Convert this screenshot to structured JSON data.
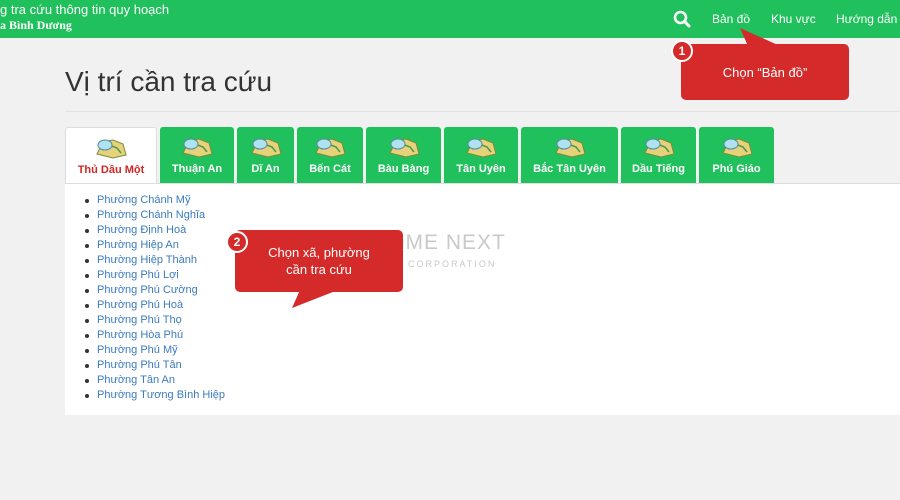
{
  "header": {
    "title_line1": "g tra cứu thông tin quy hoạch",
    "title_line2": "a Bình Dương",
    "search_icon": "search-icon",
    "nav": [
      {
        "label": "Bản đồ"
      },
      {
        "label": "Khu vực"
      },
      {
        "label": "Hướng dẫn"
      }
    ]
  },
  "page": {
    "title": "Vị trí cần tra cứu"
  },
  "tabs": [
    {
      "label": "Thủ Dầu Một",
      "active": true
    },
    {
      "label": "Thuận An"
    },
    {
      "label": "Dĩ An"
    },
    {
      "label": "Bến Cát"
    },
    {
      "label": "Bàu Bàng"
    },
    {
      "label": "Tân Uyên"
    },
    {
      "label": "Bắc Tân Uyên"
    },
    {
      "label": "Dầu Tiếng"
    },
    {
      "label": "Phú Giáo"
    }
  ],
  "wards": [
    "Phường Chánh Mỹ",
    "Phường Chánh Nghĩa",
    "Phường Định Hoà",
    "Phường Hiệp An",
    "Phường Hiệp Thành",
    "Phường Phú Lợi",
    "Phường Phú Cường",
    "Phường Phú Hoà",
    "Phường Phú Thọ",
    "Phường Hòa Phú",
    "Phường Phú Mỹ",
    "Phường Phú Tân",
    "Phường Tân An",
    "Phường Tương Bình Hiệp"
  ],
  "callouts": [
    {
      "number": "1",
      "text": "Chọn “Bản đồ”"
    },
    {
      "number": "2",
      "text_line1": "Chọn xã, phường",
      "text_line2": "cần tra cứu"
    }
  ],
  "watermark": {
    "main": "HOME NEXT",
    "sub": "CORPORATION"
  },
  "colors": {
    "primary_green": "#20c05c",
    "active_tab_text": "#d02626",
    "link_blue": "#3b7bbf",
    "callout_red": "#d42a2a"
  }
}
